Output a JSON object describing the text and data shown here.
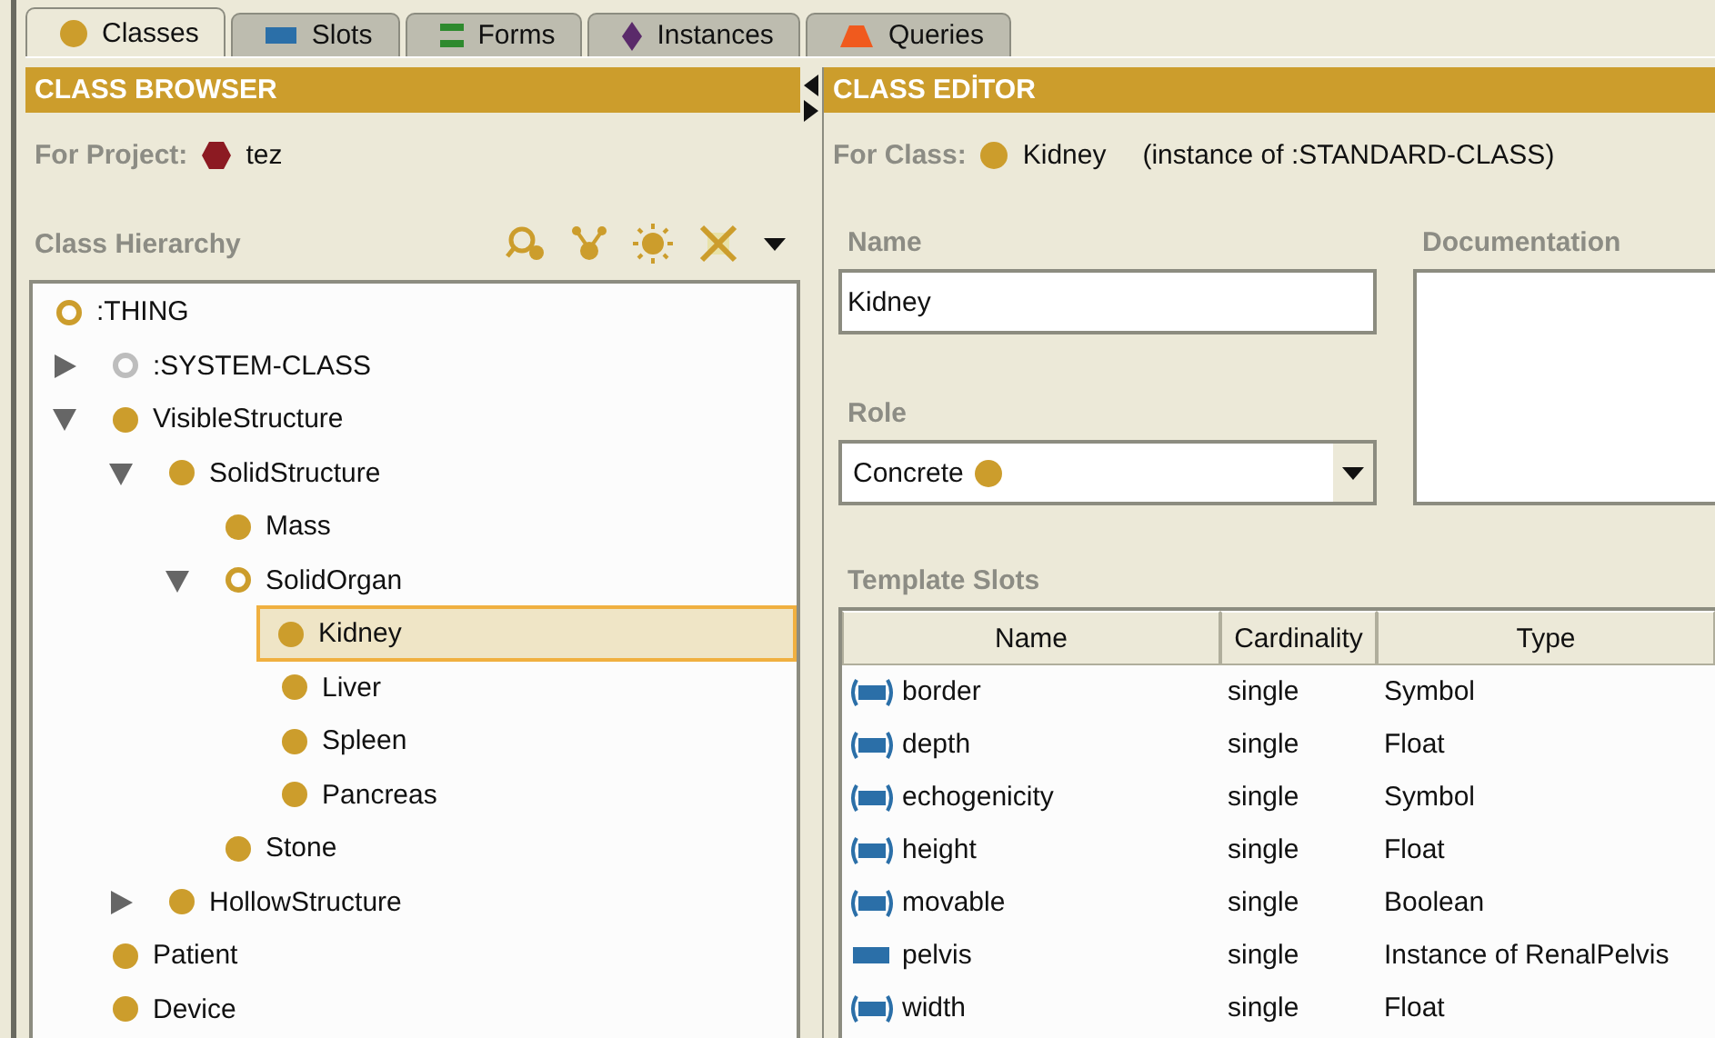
{
  "tabs": [
    {
      "label": "Classes",
      "kind": "class",
      "selected": true
    },
    {
      "label": "Slots",
      "kind": "slot",
      "selected": false
    },
    {
      "label": "Forms",
      "kind": "form",
      "selected": false
    },
    {
      "label": "Instances",
      "kind": "instance",
      "selected": false
    },
    {
      "label": "Queries",
      "kind": "query",
      "selected": false
    }
  ],
  "class_browser": {
    "title": "CLASS BROWSER",
    "project_label": "For Project:",
    "project_name": "tez",
    "hierarchy_label": "Class Hierarchy",
    "root": {
      "label": ":THING",
      "kind": "abstract",
      "selected": false,
      "children": [
        {
          "label": ":SYSTEM-CLASS",
          "kind": "system",
          "expanded": false,
          "selected": false
        },
        {
          "label": "VisibleStructure",
          "kind": "concrete",
          "expanded": true,
          "selected": false,
          "children": [
            {
              "label": "SolidStructure",
              "kind": "concrete",
              "expanded": true,
              "selected": false,
              "children": [
                {
                  "label": "Mass",
                  "kind": "concrete",
                  "selected": false
                },
                {
                  "label": "SolidOrgan",
                  "kind": "abstract",
                  "expanded": true,
                  "selected": false,
                  "children": [
                    {
                      "label": "Kidney",
                      "kind": "concrete",
                      "selected": true
                    },
                    {
                      "label": "Liver",
                      "kind": "concrete",
                      "selected": false
                    },
                    {
                      "label": "Spleen",
                      "kind": "concrete",
                      "selected": false
                    },
                    {
                      "label": "Pancreas",
                      "kind": "concrete",
                      "selected": false
                    }
                  ]
                },
                {
                  "label": "Stone",
                  "kind": "concrete",
                  "selected": false
                }
              ]
            },
            {
              "label": "HollowStructure",
              "kind": "concrete",
              "expanded": false,
              "selected": false
            }
          ]
        },
        {
          "label": "Patient",
          "kind": "concrete",
          "selected": false
        },
        {
          "label": "Device",
          "kind": "concrete",
          "selected": false
        }
      ]
    }
  },
  "class_editor": {
    "title": "CLASS EDİTOR",
    "for_class_label": "For Class:",
    "class_name": "Kidney",
    "instance_of": "(instance of :STANDARD-CLASS)",
    "name_label": "Name",
    "name_value": "Kidney",
    "documentation_label": "Documentation",
    "role_label": "Role",
    "role_value": "Concrete",
    "template_slots_label": "Template Slots",
    "columns": [
      "Name",
      "Cardinality",
      "Type"
    ],
    "rows": [
      {
        "kind": "own",
        "name": "border",
        "cardinality": "single",
        "type": "Symbol"
      },
      {
        "kind": "own",
        "name": "depth",
        "cardinality": "single",
        "type": "Float"
      },
      {
        "kind": "own",
        "name": "echogenicity",
        "cardinality": "single",
        "type": "Symbol"
      },
      {
        "kind": "own",
        "name": "height",
        "cardinality": "single",
        "type": "Float"
      },
      {
        "kind": "own",
        "name": "movable",
        "cardinality": "single",
        "type": "Boolean"
      },
      {
        "kind": "inherited",
        "name": "pelvis",
        "cardinality": "single",
        "type": "Instance of RenalPelvis"
      },
      {
        "kind": "own",
        "name": "width",
        "cardinality": "single",
        "type": "Float"
      }
    ]
  }
}
